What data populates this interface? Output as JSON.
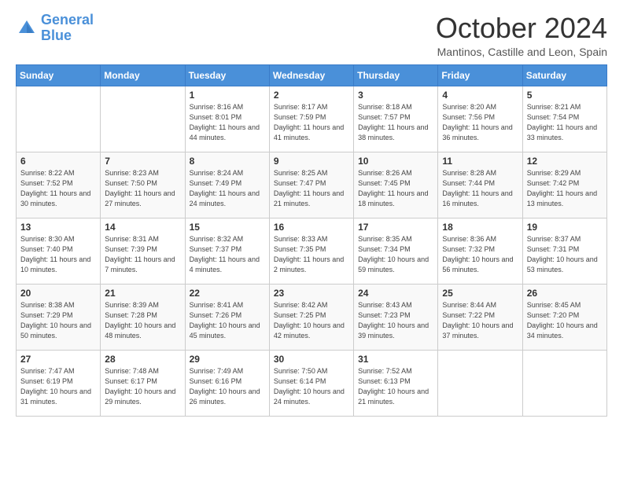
{
  "logo": {
    "line1": "General",
    "line2": "Blue"
  },
  "title": "October 2024",
  "location": "Mantinos, Castille and Leon, Spain",
  "days_of_week": [
    "Sunday",
    "Monday",
    "Tuesday",
    "Wednesday",
    "Thursday",
    "Friday",
    "Saturday"
  ],
  "weeks": [
    [
      {
        "day": "",
        "info": ""
      },
      {
        "day": "",
        "info": ""
      },
      {
        "day": "1",
        "info": "Sunrise: 8:16 AM\nSunset: 8:01 PM\nDaylight: 11 hours and 44 minutes."
      },
      {
        "day": "2",
        "info": "Sunrise: 8:17 AM\nSunset: 7:59 PM\nDaylight: 11 hours and 41 minutes."
      },
      {
        "day": "3",
        "info": "Sunrise: 8:18 AM\nSunset: 7:57 PM\nDaylight: 11 hours and 38 minutes."
      },
      {
        "day": "4",
        "info": "Sunrise: 8:20 AM\nSunset: 7:56 PM\nDaylight: 11 hours and 36 minutes."
      },
      {
        "day": "5",
        "info": "Sunrise: 8:21 AM\nSunset: 7:54 PM\nDaylight: 11 hours and 33 minutes."
      }
    ],
    [
      {
        "day": "6",
        "info": "Sunrise: 8:22 AM\nSunset: 7:52 PM\nDaylight: 11 hours and 30 minutes."
      },
      {
        "day": "7",
        "info": "Sunrise: 8:23 AM\nSunset: 7:50 PM\nDaylight: 11 hours and 27 minutes."
      },
      {
        "day": "8",
        "info": "Sunrise: 8:24 AM\nSunset: 7:49 PM\nDaylight: 11 hours and 24 minutes."
      },
      {
        "day": "9",
        "info": "Sunrise: 8:25 AM\nSunset: 7:47 PM\nDaylight: 11 hours and 21 minutes."
      },
      {
        "day": "10",
        "info": "Sunrise: 8:26 AM\nSunset: 7:45 PM\nDaylight: 11 hours and 18 minutes."
      },
      {
        "day": "11",
        "info": "Sunrise: 8:28 AM\nSunset: 7:44 PM\nDaylight: 11 hours and 16 minutes."
      },
      {
        "day": "12",
        "info": "Sunrise: 8:29 AM\nSunset: 7:42 PM\nDaylight: 11 hours and 13 minutes."
      }
    ],
    [
      {
        "day": "13",
        "info": "Sunrise: 8:30 AM\nSunset: 7:40 PM\nDaylight: 11 hours and 10 minutes."
      },
      {
        "day": "14",
        "info": "Sunrise: 8:31 AM\nSunset: 7:39 PM\nDaylight: 11 hours and 7 minutes."
      },
      {
        "day": "15",
        "info": "Sunrise: 8:32 AM\nSunset: 7:37 PM\nDaylight: 11 hours and 4 minutes."
      },
      {
        "day": "16",
        "info": "Sunrise: 8:33 AM\nSunset: 7:35 PM\nDaylight: 11 hours and 2 minutes."
      },
      {
        "day": "17",
        "info": "Sunrise: 8:35 AM\nSunset: 7:34 PM\nDaylight: 10 hours and 59 minutes."
      },
      {
        "day": "18",
        "info": "Sunrise: 8:36 AM\nSunset: 7:32 PM\nDaylight: 10 hours and 56 minutes."
      },
      {
        "day": "19",
        "info": "Sunrise: 8:37 AM\nSunset: 7:31 PM\nDaylight: 10 hours and 53 minutes."
      }
    ],
    [
      {
        "day": "20",
        "info": "Sunrise: 8:38 AM\nSunset: 7:29 PM\nDaylight: 10 hours and 50 minutes."
      },
      {
        "day": "21",
        "info": "Sunrise: 8:39 AM\nSunset: 7:28 PM\nDaylight: 10 hours and 48 minutes."
      },
      {
        "day": "22",
        "info": "Sunrise: 8:41 AM\nSunset: 7:26 PM\nDaylight: 10 hours and 45 minutes."
      },
      {
        "day": "23",
        "info": "Sunrise: 8:42 AM\nSunset: 7:25 PM\nDaylight: 10 hours and 42 minutes."
      },
      {
        "day": "24",
        "info": "Sunrise: 8:43 AM\nSunset: 7:23 PM\nDaylight: 10 hours and 39 minutes."
      },
      {
        "day": "25",
        "info": "Sunrise: 8:44 AM\nSunset: 7:22 PM\nDaylight: 10 hours and 37 minutes."
      },
      {
        "day": "26",
        "info": "Sunrise: 8:45 AM\nSunset: 7:20 PM\nDaylight: 10 hours and 34 minutes."
      }
    ],
    [
      {
        "day": "27",
        "info": "Sunrise: 7:47 AM\nSunset: 6:19 PM\nDaylight: 10 hours and 31 minutes."
      },
      {
        "day": "28",
        "info": "Sunrise: 7:48 AM\nSunset: 6:17 PM\nDaylight: 10 hours and 29 minutes."
      },
      {
        "day": "29",
        "info": "Sunrise: 7:49 AM\nSunset: 6:16 PM\nDaylight: 10 hours and 26 minutes."
      },
      {
        "day": "30",
        "info": "Sunrise: 7:50 AM\nSunset: 6:14 PM\nDaylight: 10 hours and 24 minutes."
      },
      {
        "day": "31",
        "info": "Sunrise: 7:52 AM\nSunset: 6:13 PM\nDaylight: 10 hours and 21 minutes."
      },
      {
        "day": "",
        "info": ""
      },
      {
        "day": "",
        "info": ""
      }
    ]
  ]
}
